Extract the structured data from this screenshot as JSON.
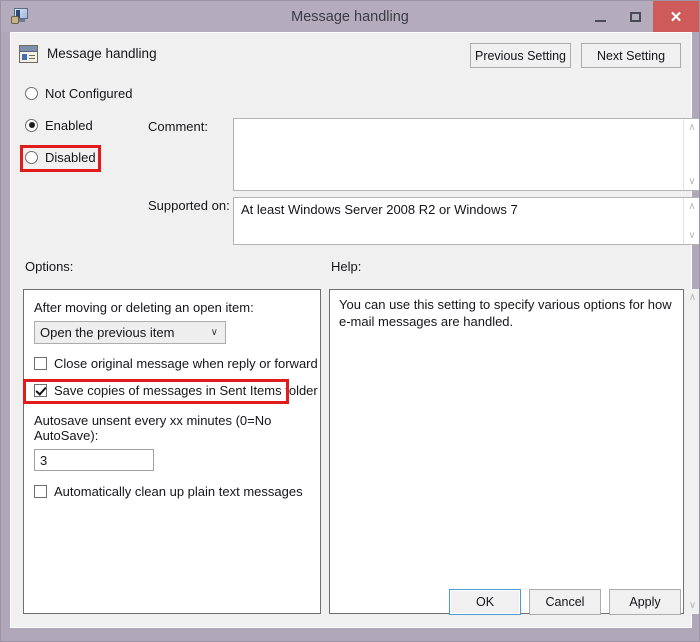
{
  "window": {
    "title": "Message handling",
    "icon": "gpo-setting-icon",
    "caption": {
      "minimize": "–",
      "maximize": "☐",
      "close": "✕"
    }
  },
  "header": {
    "icon": "policy-setting-icon",
    "title": "Message handling",
    "previous_setting": "Previous Setting",
    "next_setting": "Next Setting"
  },
  "state": {
    "options": [
      {
        "label": "Not Configured",
        "selected": false
      },
      {
        "label": "Enabled",
        "selected": true
      },
      {
        "label": "Disabled",
        "selected": false
      }
    ]
  },
  "comment": {
    "label": "Comment:",
    "value": "",
    "scroll_up": "∧",
    "scroll_down": "∨"
  },
  "supported_on": {
    "label": "Supported on:",
    "value": "At least Windows Server 2008 R2 or Windows 7",
    "scroll_up": "∧",
    "scroll_down": "∨"
  },
  "options_panel": {
    "label": "Options:",
    "dropdown_label": "After moving or deleting an open item:",
    "dropdown_value": "Open the previous item",
    "dropdown_chevron": "∨",
    "checkbox_close_original": {
      "label": "Close original message when reply or forward",
      "checked": false
    },
    "checkbox_save_copies": {
      "label": "Save copies of messages in Sent Items folder",
      "checked": true
    },
    "autosave_label": "Autosave unsent every xx minutes (0=No AutoSave):",
    "autosave_value": "3",
    "checkbox_clean_plain_text": {
      "label": "Automatically clean up plain text messages",
      "checked": false
    }
  },
  "help_panel": {
    "label": "Help:",
    "text": "You can use this setting to specify various options for how e-mail messages are handled.",
    "scroll_up": "∧",
    "scroll_down": "∨"
  },
  "footer": {
    "ok": "OK",
    "cancel": "Cancel",
    "apply": "Apply"
  },
  "colors": {
    "highlight": "#e01b1b",
    "titlebar": "#b4acbd",
    "close_button": "#cf5a5a",
    "dialog_bg": "#f0f0f0",
    "focus_border": "#4c9ad4"
  }
}
